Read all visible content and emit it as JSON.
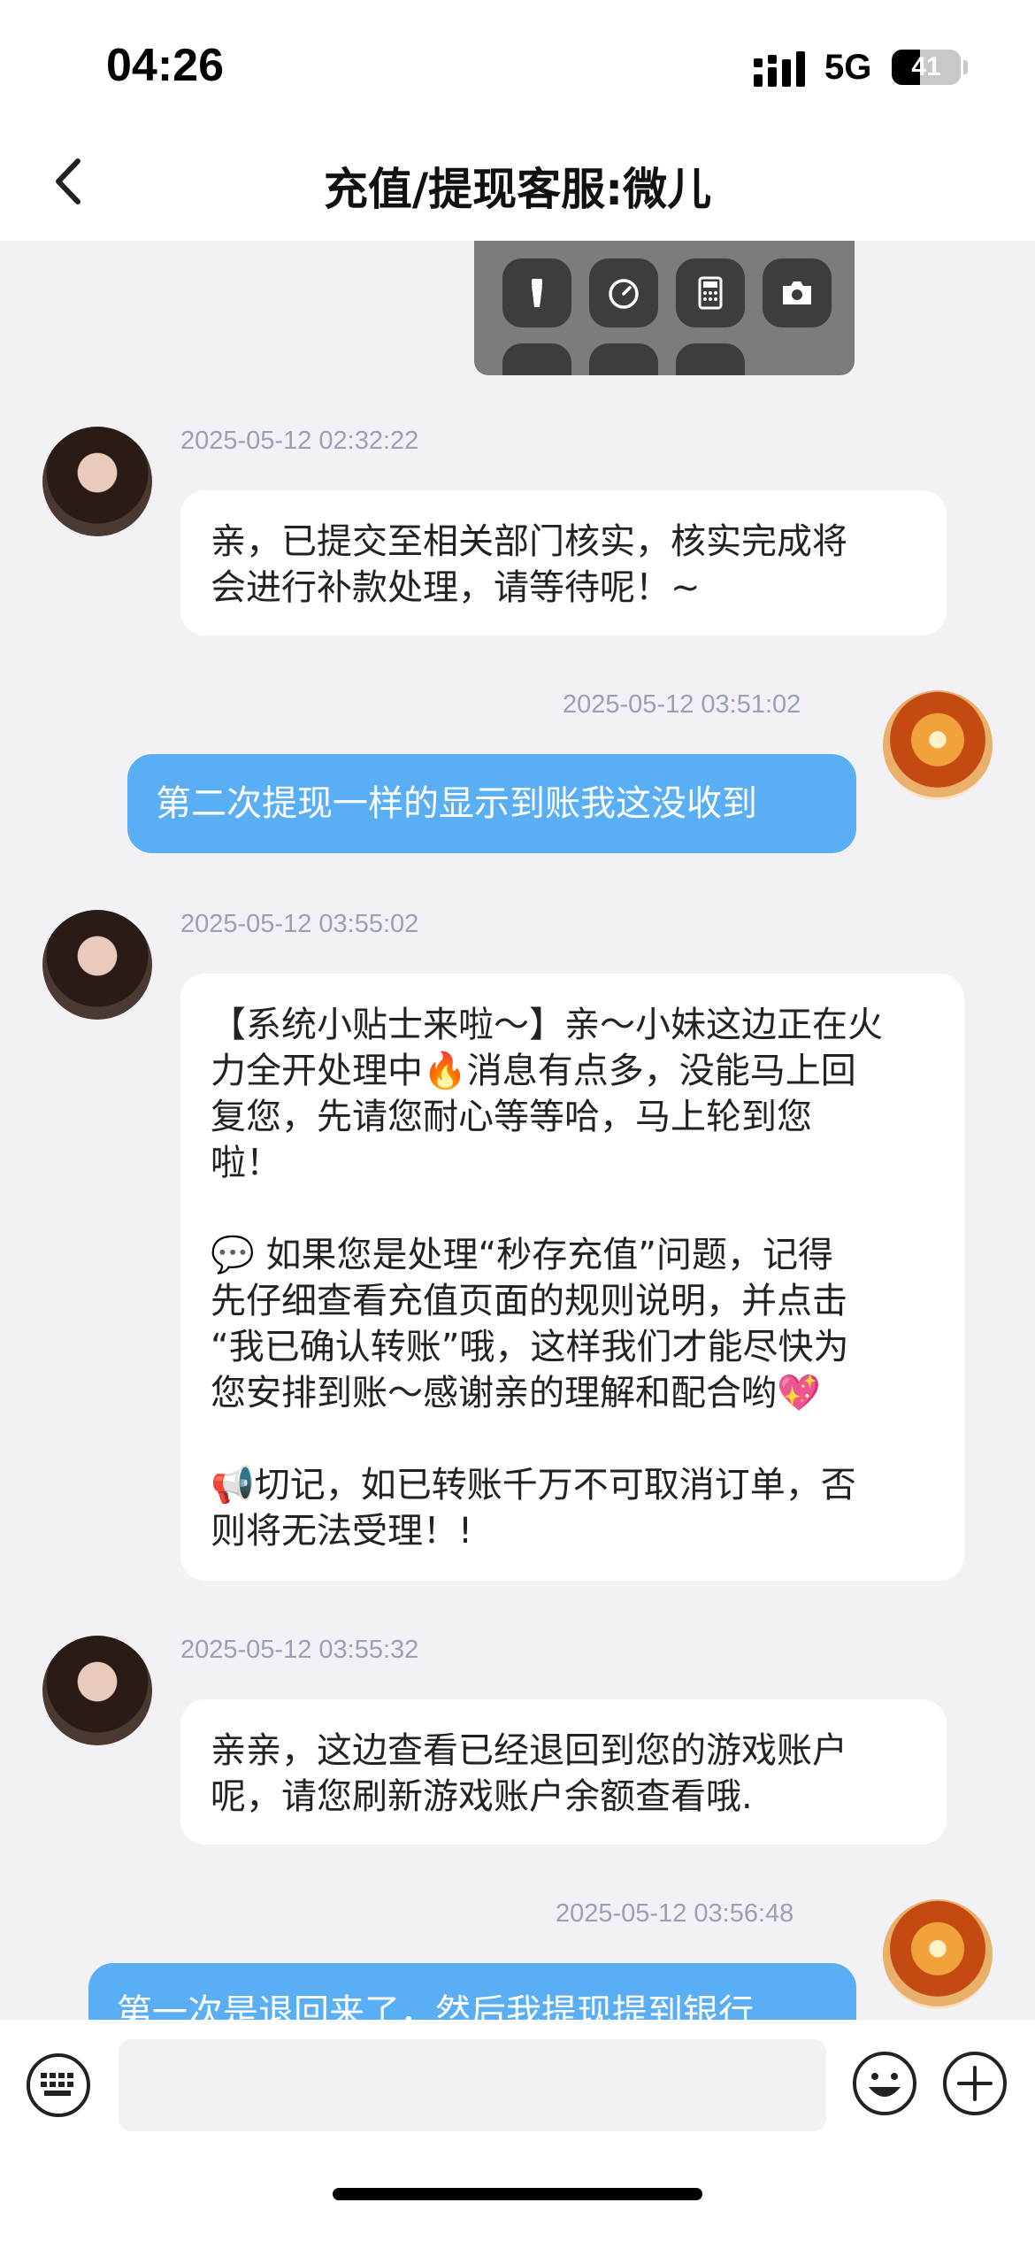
{
  "status_bar": {
    "time": "04:26",
    "network": "5G",
    "battery_percent": "41",
    "battery_level": 0.41
  },
  "nav": {
    "title": "充值/提现客服:微儿"
  },
  "messages": [
    {
      "side": "in",
      "time": "2025-05-12 02:32:22",
      "text": "亲，已提交至相关部门核实，核实完成将\n会进行补款处理，请等待呢！~"
    },
    {
      "side": "out",
      "time": "2025-05-12 03:51:02",
      "text": "第二次提现一样的显示到账我这没收到"
    },
    {
      "side": "in",
      "time": "2025-05-12 03:55:02",
      "text_lines": [
        "【系统小贴士来啦～】亲～小妹这边正在火",
        "力全开处理中🔥消息有点多，没能马上回",
        "复您，先请您耐心等等哈，马上轮到您",
        "啦！",
        "",
        "💬 如果您是处理“秒存充值”问题，记得",
        "先仔细查看充值页面的规则说明，并点击",
        "“我已确认转账”哦，这样我们才能尽快为",
        "您安排到账～感谢亲的理解和配合哟💖",
        "",
        "📢切记，如已转账千万不可取消订单，否",
        "则将无法受理！!"
      ]
    },
    {
      "side": "in",
      "time": "2025-05-12 03:55:32",
      "text": "亲亲，这边查看已经退回到您的游戏账户\n呢，请您刷新游戏账户余额查看哦."
    },
    {
      "side": "out",
      "time": "2025-05-12 03:56:48",
      "text": "第一次是退回来了，然后我提现提到银行"
    }
  ],
  "input": {
    "placeholder": ""
  },
  "icons": {
    "back": "chevron-left-icon",
    "keyboard": "keyboard-icon",
    "emoji": "emoji-icon",
    "plus": "plus-icon",
    "control_center": [
      "flashlight-icon",
      "timer-icon",
      "calculator-icon",
      "camera-icon"
    ]
  },
  "colors": {
    "outgoing_bubble": "#5aaef4",
    "incoming_bubble": "#ffffff",
    "chat_background": "#f2f2f6",
    "timestamp": "#9aa0b5"
  }
}
